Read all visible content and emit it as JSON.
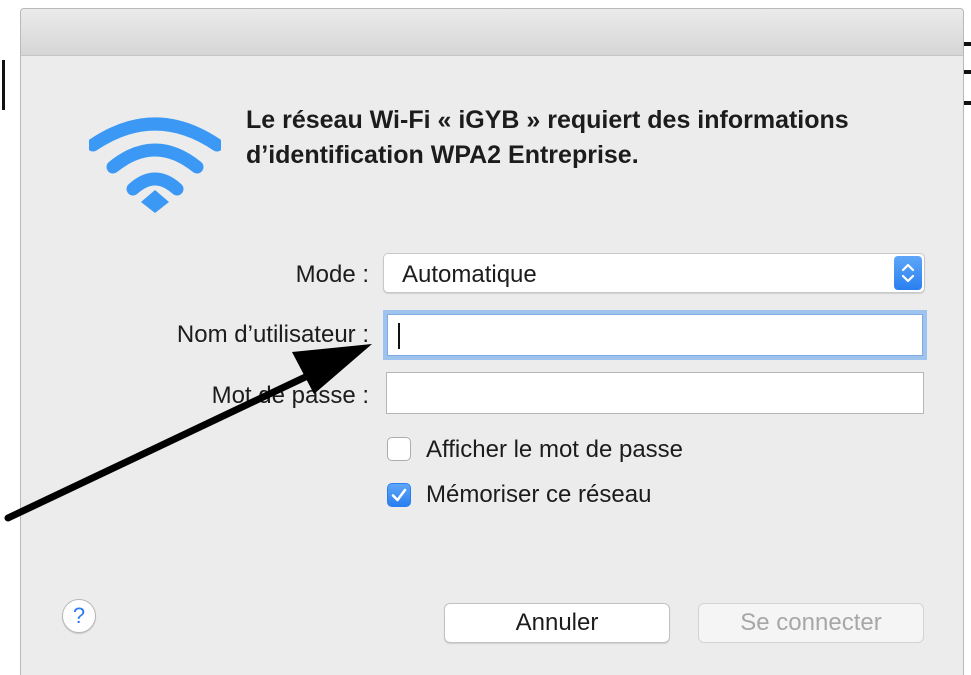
{
  "dialog": {
    "heading": "Le réseau Wi-Fi « iGYB » requiert des informations d’identification WPA2 Entreprise.",
    "mode_label": "Mode :",
    "mode_value": "Automatique",
    "username_label": "Nom d’utilisateur :",
    "username_value": "",
    "password_label": "Mot de passe :",
    "password_value": "",
    "show_password_label": "Afficher le mot de passe",
    "show_password_checked": false,
    "remember_label": "Mémoriser ce réseau",
    "remember_checked": true,
    "help_label": "?",
    "cancel_label": "Annuler",
    "connect_label": "Se connecter"
  },
  "icons": {
    "wifi": "wifi-icon",
    "stepper": "select-stepper-icon",
    "checkmark": "checkmark-icon",
    "help": "help-icon"
  },
  "colors": {
    "accent": "#2a7ff0",
    "wifi_blue": "#3b99f5",
    "focus_ring": "#9ec3ef",
    "disabled_text": "#a7a7a7"
  }
}
